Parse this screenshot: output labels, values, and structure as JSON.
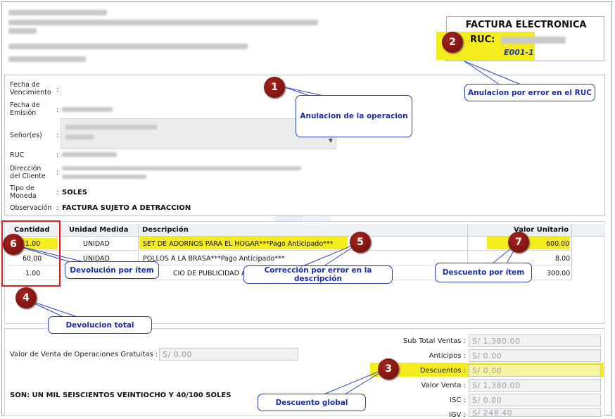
{
  "invoice": {
    "title": "FACTURA ELECTRONICA",
    "ruc_label": "RUC:",
    "number": "E001-1"
  },
  "form": {
    "fecha_vencimiento_label": "Fecha de Vencimiento",
    "fecha_emision_label": "Fecha de Emisión",
    "senor_label": "Señor(es)",
    "ruc_label": "RUC",
    "direccion_label": "Dirección del Cliente",
    "tipo_moneda_label": "Tipo de Moneda",
    "tipo_moneda_value": "SOLES",
    "observacion_label": "Observación",
    "observacion_value": "FACTURA SUJETO A DETRACCION",
    "colon": ":"
  },
  "items_table": {
    "headers": [
      "Cantidad",
      "Unidad Medida",
      "Descripción",
      "Valor Unitario"
    ],
    "rows": [
      {
        "cantidad": "1.00",
        "unidad": "UNIDAD",
        "descripcion": "SET DE ADORNOS PARA EL HOGAR***Pago Anticipado***",
        "valor": "600.00"
      },
      {
        "cantidad": "60.00",
        "unidad": "UNIDAD",
        "descripcion": "POLLOS A LA BRASA***Pago Anticipado***",
        "valor": "8.00"
      },
      {
        "cantidad": "1.00",
        "unidad": "",
        "descripcion": "CIO DE PUBLICIDAD A E",
        "valor": "300.00"
      }
    ]
  },
  "totals": {
    "gratuitas_label": "Valor de Venta de Operaciones Gratuitas :",
    "gratuitas_value": "S/ 0.00",
    "son_text": "SON: UN MIL SEISCIENTOS VEINTIOCHO Y 40/100 SOLES",
    "sub_total_label": "Sub Total Ventas :",
    "sub_total_value": "S/ 1,380.00",
    "anticipos_label": "Anticipos :",
    "anticipos_value": "S/ 0.00",
    "descuentos_label": "Descuentos :",
    "descuentos_value": "S/ 0.00",
    "valor_venta_label": "Valor Venta :",
    "valor_venta_value": "S/ 1,380.00",
    "isc_label": "ISC :",
    "isc_value": "S/ 0.00",
    "igv_label": "IGV :",
    "igv_value": "S/ 248.40"
  },
  "callouts": {
    "c1": {
      "number": "1",
      "text": "Anulacion de la operacion"
    },
    "c2": {
      "number": "2",
      "text": "Anulacion por error en el RUC"
    },
    "c3": {
      "number": "3",
      "text": "Descuento global"
    },
    "c4": {
      "number": "4",
      "text": "Devolucion total"
    },
    "c5": {
      "number": "5",
      "text": "Corrección por error en la descripción"
    },
    "c6": {
      "number": "6",
      "text": "Devolución por ítem"
    },
    "c7": {
      "number": "7",
      "text": "Descuento por ítem"
    }
  },
  "colors": {
    "highlight": "#f4ec1c",
    "callout_border": "#2d3fb0",
    "badge": "#8b1a14",
    "red_box": "#e02020"
  }
}
